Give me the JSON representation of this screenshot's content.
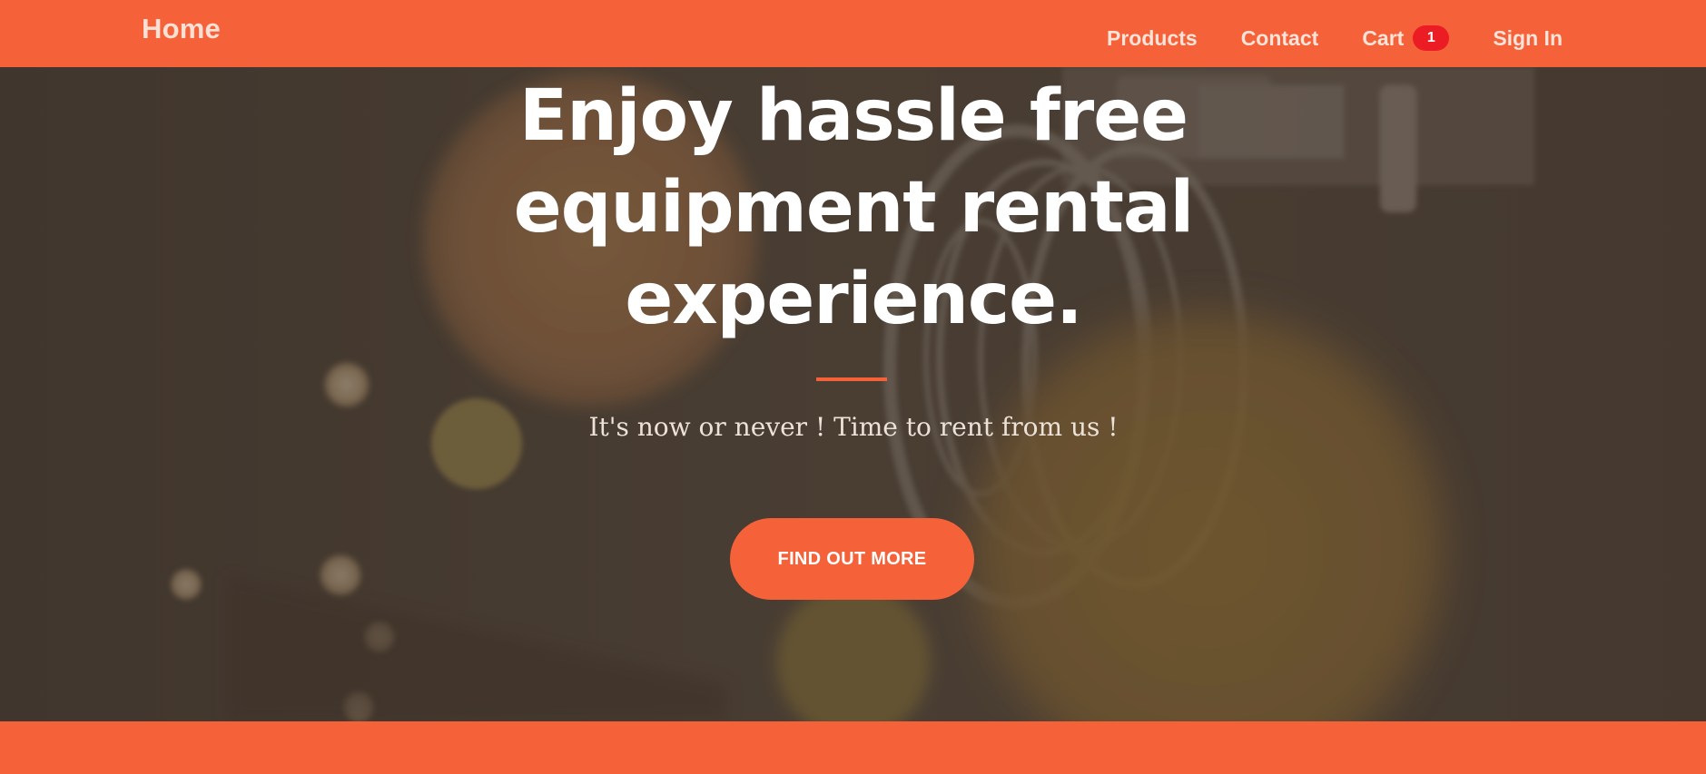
{
  "navbar": {
    "brand": "Home",
    "links": [
      {
        "label": "Products"
      },
      {
        "label": "Contact"
      },
      {
        "label": "Cart",
        "badge": "1"
      },
      {
        "label": "Sign In"
      }
    ]
  },
  "hero": {
    "title": "Enjoy hassle free equipment rental experience.",
    "subtitle": "It's now or never ! Time to rent from us !",
    "cta_label": "FIND OUT MORE"
  },
  "colors": {
    "accent": "#f5623a",
    "badge": "#ec1c24",
    "hero_overlay": "#4c4036"
  }
}
